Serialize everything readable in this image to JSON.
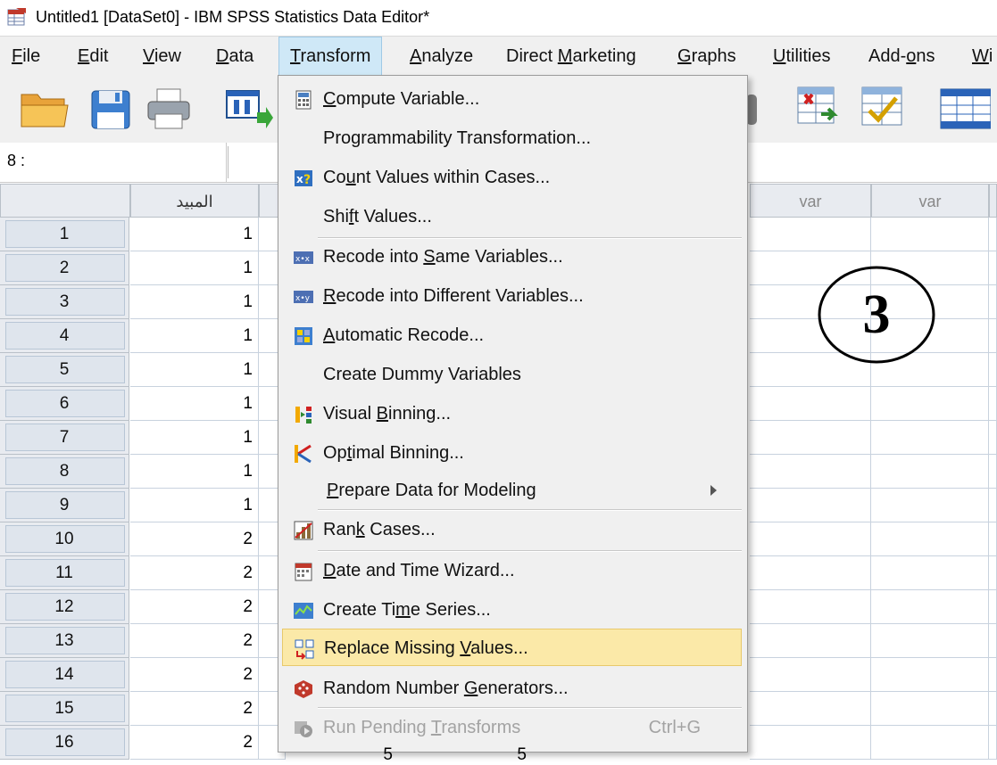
{
  "window": {
    "title": "Untitled1 [DataSet0] - IBM SPSS Statistics Data Editor*"
  },
  "menubar": [
    {
      "label": "File",
      "u": "F",
      "rest": "ile"
    },
    {
      "label": "Edit",
      "u": "E",
      "rest": "dit"
    },
    {
      "label": "View",
      "u": "V",
      "rest": "iew"
    },
    {
      "label": "Data",
      "u": "D",
      "rest": "ata"
    },
    {
      "label": "Transform",
      "u": "T",
      "rest": "ransform"
    },
    {
      "label": "Analyze",
      "u": "A",
      "rest": "nalyze"
    },
    {
      "label": "Direct Marketing",
      "pre": "Direct ",
      "u": "M",
      "rest": "arketing"
    },
    {
      "label": "Graphs",
      "u": "G",
      "rest": "raphs"
    },
    {
      "label": "Utilities",
      "u": "U",
      "rest": "tilities"
    },
    {
      "label": "Add-ons",
      "pre": "Add-",
      "u": "o",
      "rest": "ns"
    },
    {
      "label": "Wi",
      "u": "W",
      "rest": "i"
    }
  ],
  "cell_ref": "8 :",
  "columns": {
    "first": "المبيد",
    "var1": "var",
    "var2": "var"
  },
  "rows": [
    {
      "n": "1",
      "v": "1"
    },
    {
      "n": "2",
      "v": "1"
    },
    {
      "n": "3",
      "v": "1"
    },
    {
      "n": "4",
      "v": "1"
    },
    {
      "n": "5",
      "v": "1"
    },
    {
      "n": "6",
      "v": "1"
    },
    {
      "n": "7",
      "v": "1"
    },
    {
      "n": "8",
      "v": "1"
    },
    {
      "n": "9",
      "v": "1"
    },
    {
      "n": "10",
      "v": "2"
    },
    {
      "n": "11",
      "v": "2"
    },
    {
      "n": "12",
      "v": "2"
    },
    {
      "n": "13",
      "v": "2"
    },
    {
      "n": "14",
      "v": "2"
    },
    {
      "n": "15",
      "v": "2"
    },
    {
      "n": "16",
      "v": "2"
    }
  ],
  "row16_partial": [
    "5",
    "5"
  ],
  "transform_menu": {
    "compute": {
      "pre": "",
      "u": "C",
      "rest": "ompute Variable..."
    },
    "programmability": {
      "pre": "Programmability Transformation...",
      "u": "",
      "rest": ""
    },
    "count": {
      "pre": "Co",
      "u": "u",
      "rest": "nt Values within Cases..."
    },
    "shift": {
      "pre": "Shi",
      "u": "f",
      "rest": "t Values..."
    },
    "recode_same": {
      "pre": "Recode into ",
      "u": "S",
      "rest": "ame Variables..."
    },
    "recode_diff": {
      "pre": "",
      "u": "R",
      "rest": "ecode into Different Variables..."
    },
    "auto_recode": {
      "pre": "",
      "u": "A",
      "rest": "utomatic Recode..."
    },
    "dummy": {
      "pre": "Create Dummy Variables",
      "u": "",
      "rest": ""
    },
    "visual_binning": {
      "pre": "Visual ",
      "u": "B",
      "rest": "inning..."
    },
    "optimal_binning": {
      "pre": "Op",
      "u": "t",
      "rest": "imal Binning..."
    },
    "prepare": {
      "pre": "",
      "u": "P",
      "rest": "repare Data for Modeling"
    },
    "rank": {
      "pre": "Ran",
      "u": "k",
      "rest": " Cases..."
    },
    "datetime": {
      "pre": "",
      "u": "D",
      "rest": "ate and Time Wizard..."
    },
    "timeseries": {
      "pre": "Create Ti",
      "u": "m",
      "rest": "e Series..."
    },
    "replace_missing": {
      "pre": "Replace Missing ",
      "u": "V",
      "rest": "alues..."
    },
    "random": {
      "pre": "Random Number ",
      "u": "G",
      "rest": "enerators..."
    },
    "run_pending": {
      "pre": "Run Pending ",
      "u": "T",
      "rest": "ransforms"
    },
    "run_pending_shortcut": "Ctrl+G"
  },
  "annotation": "3",
  "colors": {
    "menu_highlight": "#fbe9a8",
    "active_menu": "#cfe8f7",
    "header_bg": "#e8ebf0"
  }
}
